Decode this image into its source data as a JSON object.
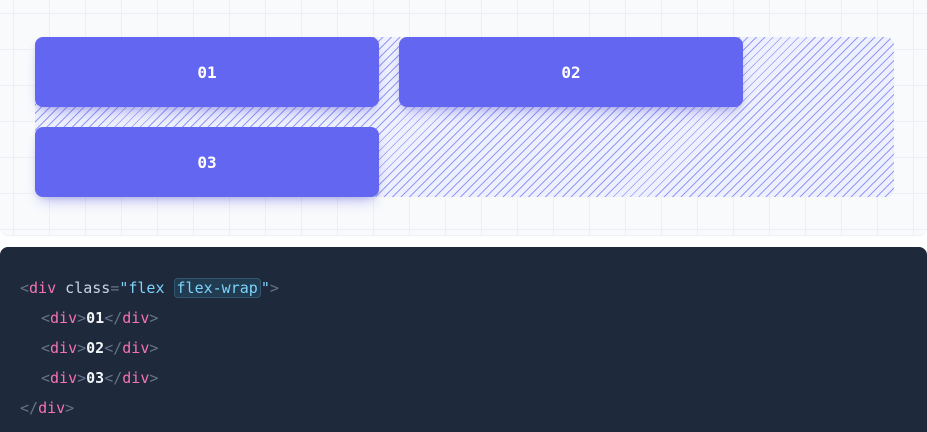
{
  "preview": {
    "items": [
      {
        "label": "01"
      },
      {
        "label": "02"
      },
      {
        "label": "03"
      }
    ]
  },
  "code": {
    "tag_name": "div",
    "attr_name": "class",
    "class_first": "flex",
    "class_highlight": "flex-wrap",
    "children": [
      {
        "tag": "div",
        "text": "01"
      },
      {
        "tag": "div",
        "text": "02"
      },
      {
        "tag": "div",
        "text": "03"
      }
    ]
  },
  "colors": {
    "item_bg": "#6366f1",
    "code_bg": "#1e293b",
    "tag": "#f472b6",
    "string": "#7dd3fc"
  }
}
